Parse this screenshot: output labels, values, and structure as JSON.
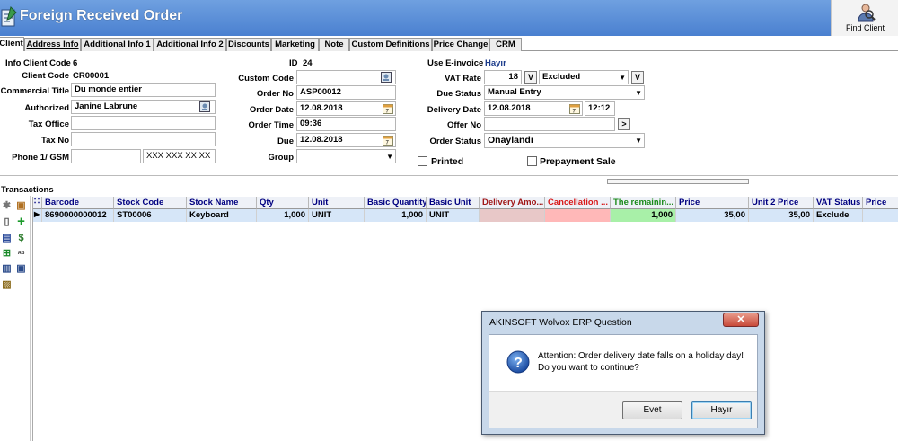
{
  "window": {
    "title": "Foreign Received Order",
    "find_client": "Find Client"
  },
  "tabs": [
    "Client",
    "Address Info",
    "Additional Info 1",
    "Additional Info 2",
    "Discounts",
    "Marketing",
    "Note",
    "Custom Definitions",
    "Price Change",
    "CRM"
  ],
  "client": {
    "info_client_code_label": "Info Client Code",
    "info_client_code": "6",
    "client_code_label": "Client Code",
    "client_code": "CR00001",
    "commercial_title_label": "Commercial Title",
    "commercial_title": "Du monde entier",
    "authorized_label": "Authorized",
    "authorized": "Janine Labrune",
    "tax_office_label": "Tax Office",
    "tax_office": "",
    "tax_no_label": "Tax No",
    "tax_no": "",
    "phone_label": "Phone 1/ GSM",
    "phone": "",
    "gsm": "XXX XXX XX XX"
  },
  "order": {
    "id_label": "ID",
    "id": "24",
    "custom_code_label": "Custom Code",
    "custom_code": "",
    "order_no_label": "Order No",
    "order_no": "ASP00012",
    "order_date_label": "Order Date",
    "order_date": "12.08.2018",
    "order_time_label": "Order Time",
    "order_time": "09:36",
    "due_label": "Due",
    "due": "12.08.2018",
    "group_label": "Group",
    "group": ""
  },
  "right": {
    "einvoice_label": "Use E-invoice",
    "einvoice": "Hayır",
    "vat_rate_label": "VAT Rate",
    "vat_rate": "18",
    "vat_btn": "V",
    "vat_mode": "Excluded",
    "due_status_label": "Due Status",
    "due_status": "Manual Entry",
    "delivery_date_label": "Delivery Date",
    "delivery_date": "12.08.2018",
    "delivery_time": "12:12",
    "offer_no_label": "Offer No",
    "offer_no": "",
    "offer_btn": ">",
    "order_status_label": "Order Status",
    "order_status": "Onaylandı",
    "printed": "Printed",
    "prepayment": "Prepayment Sale"
  },
  "transactions": {
    "label": "Transactions",
    "columns": [
      "Barcode",
      "Stock Code",
      "Stock Name",
      "Qty",
      "Unit",
      "Basic Quantity",
      "Basic Unit",
      "Delivery Amo...",
      "Cancellation ...",
      "The remainin...",
      "Price",
      "Unit 2 Price",
      "VAT Status",
      "Price"
    ],
    "row": [
      "8690000000012",
      "ST00006",
      "Keyboard",
      "1,000",
      "UNIT",
      "1,000",
      "UNIT",
      "",
      "",
      "1,000",
      "35,00",
      "35,00",
      "Exclude",
      ""
    ]
  },
  "dialog": {
    "title": "AKINSOFT Wolvox ERP Question",
    "line1": "Attention: Order delivery date falls on a holiday day!",
    "line2": "Do you want to continue?",
    "yes": "Evet",
    "no": "Hayır"
  },
  "colors": {
    "title_bar": "#4a80d0",
    "delivery_col": "#e8c8c8",
    "cancel_col": "#ffb8b8",
    "remaining_col": "#a8f0a8"
  }
}
